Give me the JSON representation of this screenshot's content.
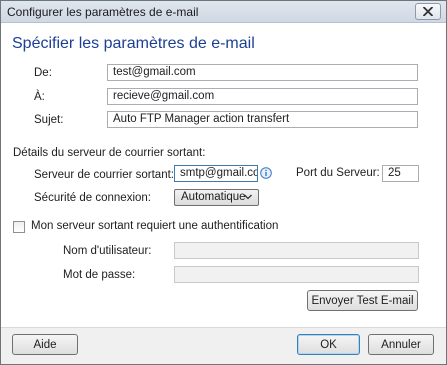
{
  "window": {
    "title": "Configurer les paramètres de e-mail"
  },
  "heading": "Spécifier les paramètres de e-mail",
  "message": {
    "from_label": "De:",
    "from_value": "test@gmail.com",
    "to_label": "À:",
    "to_value": "recieve@gmail.com",
    "subject_label": "Sujet:",
    "subject_value": "Auto FTP Manager action transfert"
  },
  "server": {
    "section_label": "Détails du serveur de courrier sortant:",
    "smtp_label": "Serveur de courrier sortant:",
    "smtp_value": "smtp@gmail.com",
    "port_label": "Port du Serveur:",
    "port_value": "25",
    "security_label": "Sécurité de connexion:",
    "security_value": "Automatique",
    "auth_checkbox_label": "Mon serveur sortant requiert une authentification",
    "auth_checked": false,
    "username_label": "Nom d'utilisateur:",
    "username_value": "",
    "password_label": "Mot de passe:",
    "password_value": "",
    "test_button": "Envoyer Test E-mail"
  },
  "footer": {
    "help_button": "Aide",
    "ok_button": "OK",
    "cancel_button": "Annuler"
  },
  "icons": {
    "close": "close-icon",
    "info": "info-icon",
    "dropdown": "chevron-down-icon"
  },
  "colors": {
    "heading": "#1c3f95",
    "info_icon": "#3a78c8"
  }
}
